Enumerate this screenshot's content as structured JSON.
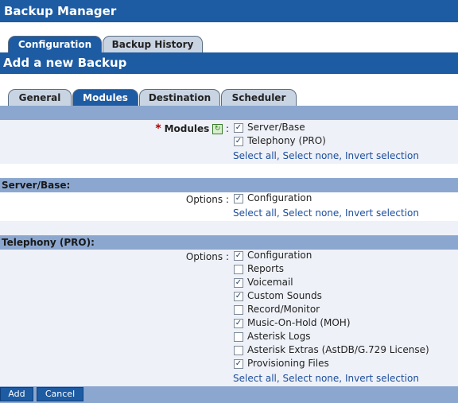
{
  "app": {
    "title": "Backup Manager"
  },
  "top_tabs": [
    {
      "label": "Configuration",
      "active": true
    },
    {
      "label": "Backup History",
      "active": false
    }
  ],
  "section_title": "Add a new Backup",
  "sub_tabs": [
    {
      "label": "General",
      "active": false
    },
    {
      "label": "Modules",
      "active": true
    },
    {
      "label": "Destination",
      "active": false
    },
    {
      "label": "Scheduler",
      "active": false
    }
  ],
  "modules": {
    "required_marker": "*",
    "label": "Modules",
    "colon": ":",
    "items": [
      {
        "label": "Server/Base",
        "checked": true
      },
      {
        "label": "Telephony (PRO)",
        "checked": true
      }
    ]
  },
  "selection_links": {
    "select_all": "Select all",
    "select_none": "Select none",
    "invert": "Invert selection",
    "sep": ","
  },
  "server_base": {
    "heading": "Server/Base:",
    "options_label": "Options :",
    "items": [
      {
        "label": "Configuration",
        "checked": true
      }
    ]
  },
  "telephony": {
    "heading": "Telephony (PRO):",
    "options_label": "Options :",
    "items": [
      {
        "label": "Configuration",
        "checked": true
      },
      {
        "label": "Reports",
        "checked": false
      },
      {
        "label": "Voicemail",
        "checked": true
      },
      {
        "label": "Custom Sounds",
        "checked": true
      },
      {
        "label": "Record/Monitor",
        "checked": false
      },
      {
        "label": "Music-On-Hold (MOH)",
        "checked": true
      },
      {
        "label": "Asterisk Logs",
        "checked": false
      },
      {
        "label": "Asterisk Extras (AstDB/G.729 License)",
        "checked": false
      },
      {
        "label": "Provisioning Files",
        "checked": true
      }
    ]
  },
  "buttons": {
    "add": "Add",
    "cancel": "Cancel"
  },
  "icons": {
    "check": "checkmark-icon",
    "refresh": "refresh-icon"
  }
}
